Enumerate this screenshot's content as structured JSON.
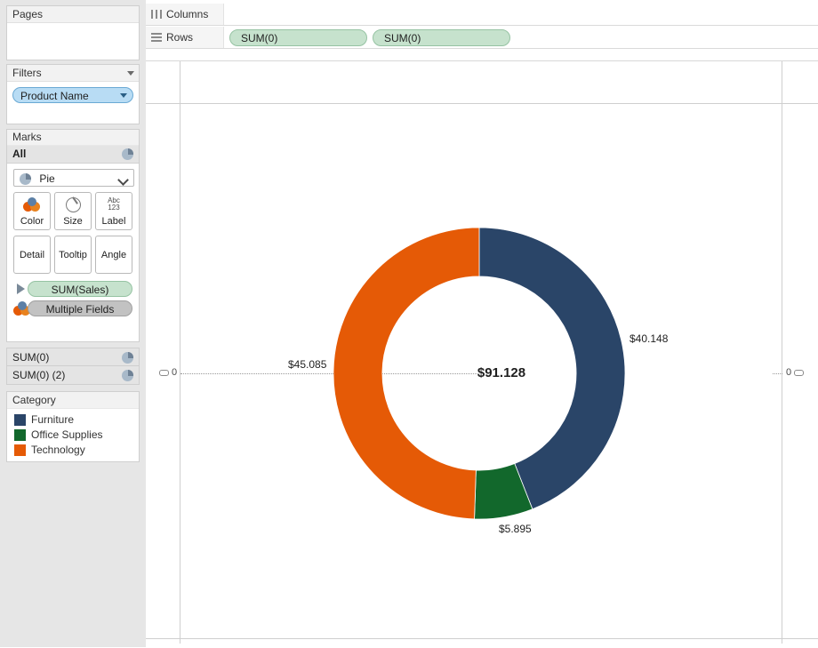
{
  "sidebar": {
    "pages": {
      "title": "Pages"
    },
    "filters": {
      "title": "Filters",
      "pills": [
        {
          "label": "Product Name"
        }
      ]
    },
    "marks": {
      "title": "Marks",
      "all_label": "All",
      "mark_type": "Pie",
      "buttons": [
        {
          "label": "Color",
          "icon": "color-icon"
        },
        {
          "label": "Size",
          "icon": "size-icon"
        },
        {
          "label": "Label",
          "icon": "abc-123-icon"
        },
        {
          "label": "Detail",
          "icon": ""
        },
        {
          "label": "Tooltip",
          "icon": ""
        },
        {
          "label": "Angle",
          "icon": ""
        }
      ],
      "pills": [
        {
          "label": "SUM(Sales)",
          "style": "green",
          "icon": "angle-triangle-icon"
        },
        {
          "label": "Multiple Fields",
          "style": "grey",
          "icon": "color-icon"
        }
      ]
    },
    "sum_rows": [
      {
        "label": "SUM(0)"
      },
      {
        "label": "SUM(0) (2)"
      }
    ],
    "legend": {
      "title": "Category",
      "items": [
        {
          "label": "Furniture",
          "color": "#2a4568"
        },
        {
          "label": "Office Supplies",
          "color": "#12682c"
        },
        {
          "label": "Technology",
          "color": "#e55a06"
        }
      ]
    }
  },
  "shelves": {
    "columns": {
      "label": "Columns",
      "pills": []
    },
    "rows": {
      "label": "Rows",
      "pills": [
        {
          "label": "SUM(0)"
        },
        {
          "label": "SUM(0)"
        }
      ]
    }
  },
  "view": {
    "axis_zero_left": "0",
    "axis_zero_right": "0",
    "center_total": "$91.128"
  },
  "chart_data": {
    "type": "pie",
    "title": "",
    "donut": true,
    "total": 91.128,
    "total_label": "$91.128",
    "legend_title": "Category",
    "legend_position": "left-sidebar",
    "start_angle_deg": 0,
    "direction": "clockwise",
    "inner_radius_ratio": 0.665,
    "categories": [
      "Furniture",
      "Office Supplies",
      "Technology"
    ],
    "values": [
      40.148,
      5.895,
      45.085
    ],
    "labels": [
      "$40.148",
      "$5.895",
      "$45.085"
    ],
    "colors": [
      "#2a4568",
      "#12682c",
      "#e55a06"
    ],
    "percentages": [
      44.1,
      6.5,
      49.5
    ],
    "slices": [
      {
        "name": "Furniture",
        "value": 40.148,
        "label": "$40.148",
        "color": "#2a4568",
        "start_deg": 0.0,
        "end_deg": 158.6
      },
      {
        "name": "Office Supplies",
        "value": 5.895,
        "label": "$5.895",
        "color": "#12682c",
        "start_deg": 158.6,
        "end_deg": 181.9
      },
      {
        "name": "Technology",
        "value": 45.085,
        "label": "$45.085",
        "color": "#e55a06",
        "start_deg": 181.9,
        "end_deg": 360.0
      }
    ]
  }
}
